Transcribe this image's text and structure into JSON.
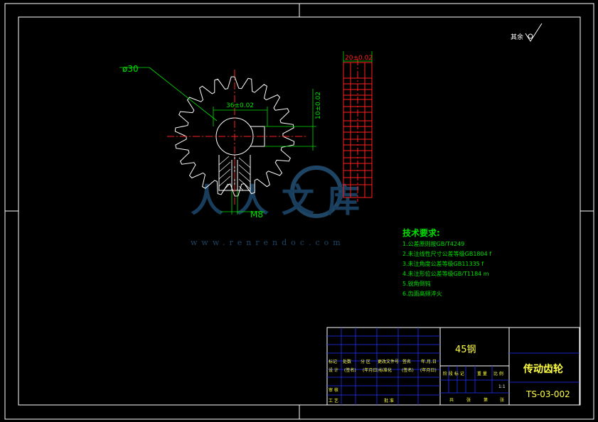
{
  "dimensions": {
    "outer_diameter": "ø30",
    "keyway_width": "36±0.02",
    "keyway_depth": "10±0.02",
    "face_width": "20±0.02",
    "thread": "M8"
  },
  "surface_note": {
    "label": "其余"
  },
  "tech_requirements": {
    "title": "技术要求:",
    "items": [
      "1.公差原则按GB/T4249",
      "2.未注线性尺寸公差等级GB1804 f",
      "3.未注角度公差等级GB11335 f",
      "4.未注形位公差等级GB/T1184 m",
      "5.锐角倒钝",
      "6.齿面高频淬火"
    ]
  },
  "watermark": {
    "text": "人人文库",
    "url": "www.renrendoc.com"
  },
  "title_block": {
    "material": "45钢",
    "part_name": "传动齿轮",
    "drawing_number": "TS-03-002",
    "scale": "1:1",
    "row_revision": [
      "标记",
      "处数",
      "分 区",
      "更改文件号",
      "签名",
      "年.月.日"
    ],
    "row_design": [
      "设 计",
      "(签名)",
      "(年月日)",
      "标准化",
      "(签名)",
      "(年月日)"
    ],
    "row_review": "审 核",
    "row_process": "工 艺",
    "approve": "批 准",
    "stage_labels": [
      "阶 段 标 记",
      "重 量",
      "比 例"
    ],
    "sheet_labels": [
      "共",
      "张",
      "第",
      "张"
    ]
  },
  "colors": {
    "outline": "#ffffff",
    "center_lines": "#ff2020",
    "dimensions": "#00e000",
    "title_block_grid": "#2030ff",
    "title_block_text": "#ffff40"
  }
}
